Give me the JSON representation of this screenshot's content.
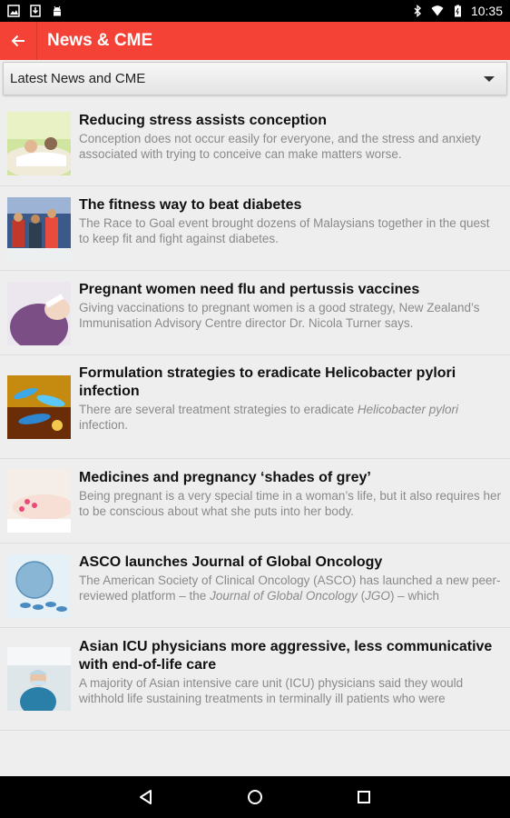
{
  "status_bar": {
    "time": "10:35",
    "left_icons": [
      "gallery-icon",
      "download-icon",
      "android-icon"
    ],
    "right_icons": [
      "bluetooth-icon",
      "wifi-icon",
      "battery-icon"
    ]
  },
  "app_bar": {
    "title": "News & CME",
    "background": "#f44336"
  },
  "filter": {
    "selected": "Latest News and CME"
  },
  "items": [
    {
      "title": "Reducing stress assists conception",
      "summary": "Conception does not occur easily for everyone, and the stress and anxiety associated with trying to conceive can make matters worse."
    },
    {
      "title": "The fitness way to beat diabetes",
      "summary": "The Race to Goal event brought dozens of Malaysians together in the quest to keep fit and fight against diabetes."
    },
    {
      "title": "Pregnant women need flu and pertussis vaccines",
      "summary": "Giving vaccinations to pregnant women is a good strategy, New Zealand’s Immunisation Advisory Centre director Dr. Nicola Turner says."
    },
    {
      "title": "Formulation strategies to eradicate Helicobacter pylori infection",
      "summary_a": "There are several treatment strategies to eradicate ",
      "summary_em": "Helicobacter pylori",
      "summary_b": " infection."
    },
    {
      "title": "Medicines and pregnancy ‘shades of grey’",
      "summary": "Being pregnant is a very special time in a woman’s life, but it also requires her to be conscious about what she puts into her body."
    },
    {
      "title": "ASCO launches Journal of Global Oncology",
      "summary_a": "The American Society of Clinical Oncology (ASCO) has launched a new peer-reviewed platform – the ",
      "summary_em": "Journal of Global Oncology",
      "summary_b": " (",
      "summary_em2": "JGO",
      "summary_c": ") – which"
    },
    {
      "title": "Asian ICU physicians more aggressive, less communicative with end-of-life care",
      "summary": "A majority of Asian intensive care unit (ICU) physicians said they would withhold life sustaining treatments in terminally ill patients who were"
    }
  ],
  "nav_bar": {
    "buttons": [
      "back-triangle-icon",
      "home-circle-icon",
      "recents-square-icon"
    ]
  }
}
